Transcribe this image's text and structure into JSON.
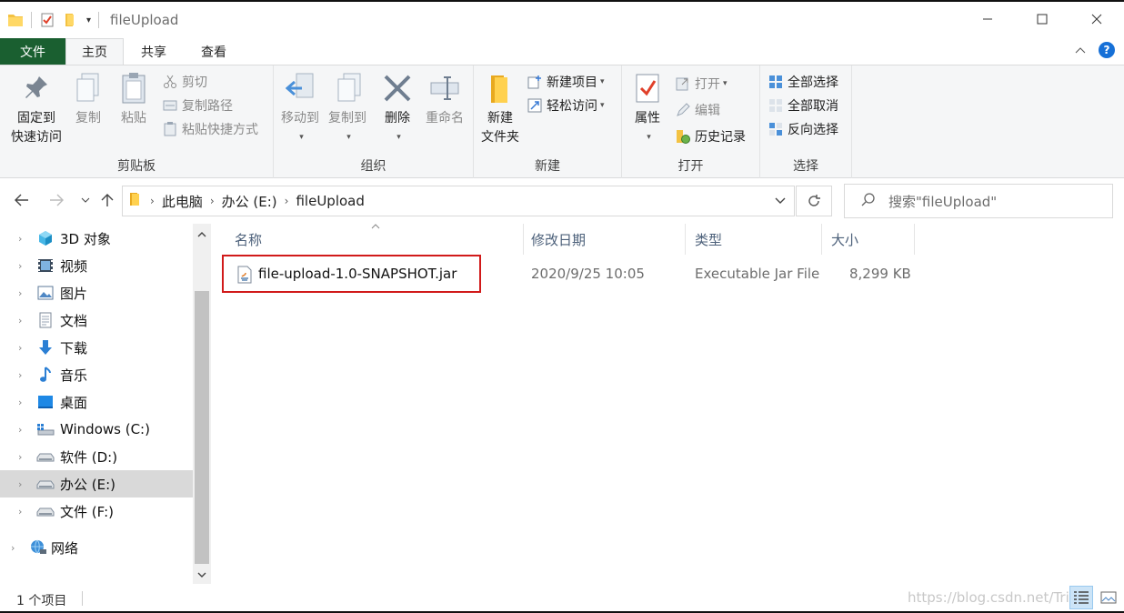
{
  "window": {
    "title": "fileUpload"
  },
  "ribbon_tabs": [
    "文件",
    "主页",
    "共享",
    "查看"
  ],
  "clipboard": {
    "pin": "固定到",
    "pin2": "快速访问",
    "copy": "复制",
    "paste": "粘贴",
    "cut": "剪切",
    "copy_path": "复制路径",
    "paste_shortcut": "粘贴快捷方式",
    "label": "剪贴板"
  },
  "organize": {
    "move_to": "移动到",
    "copy_to": "复制到",
    "delete": "删除",
    "rename": "重命名",
    "label": "组织"
  },
  "new": {
    "new_folder": "新建",
    "new_folder2": "文件夹",
    "new_item": "新建项目",
    "easy_access": "轻松访问",
    "label": "新建"
  },
  "open": {
    "properties": "属性",
    "open": "打开",
    "edit": "编辑",
    "history": "历史记录",
    "label": "打开"
  },
  "select": {
    "select_all": "全部选择",
    "select_none": "全部取消",
    "invert": "反向选择",
    "label": "选择"
  },
  "address": {
    "crumbs": [
      "此电脑",
      "办公 (E:)",
      "fileUpload"
    ]
  },
  "search": {
    "placeholder": "搜索\"fileUpload\""
  },
  "nav": {
    "items": [
      {
        "label": "3D 对象",
        "icon": "cube-icon"
      },
      {
        "label": "视频",
        "icon": "video-icon"
      },
      {
        "label": "图片",
        "icon": "picture-icon"
      },
      {
        "label": "文档",
        "icon": "document-icon"
      },
      {
        "label": "下载",
        "icon": "download-icon"
      },
      {
        "label": "音乐",
        "icon": "music-icon"
      },
      {
        "label": "桌面",
        "icon": "desktop-icon"
      },
      {
        "label": "Windows (C:)",
        "icon": "windows-drive-icon"
      },
      {
        "label": "软件 (D:)",
        "icon": "drive-icon"
      },
      {
        "label": "办公 (E:)",
        "icon": "drive-icon"
      },
      {
        "label": "文件 (F:)",
        "icon": "drive-icon"
      },
      {
        "label": "网络",
        "icon": "network-icon"
      }
    ],
    "selected": "办公 (E:)"
  },
  "columns": {
    "name": "名称",
    "modified": "修改日期",
    "type": "类型",
    "size": "大小"
  },
  "files": [
    {
      "name": "file-upload-1.0-SNAPSHOT.jar",
      "modified": "2020/9/25 10:05",
      "type": "Executable Jar File",
      "size": "8,299 KB",
      "icon": "jar-file-icon"
    }
  ],
  "status": {
    "count": "1 个项目",
    "watermark": "https://blog.csdn.net/Triste"
  },
  "colors": {
    "file_tab": "#1a5f30",
    "highlight_box": "#d11a1a",
    "header_text": "#4c607a",
    "selected_nav": "#d9d9d9"
  }
}
